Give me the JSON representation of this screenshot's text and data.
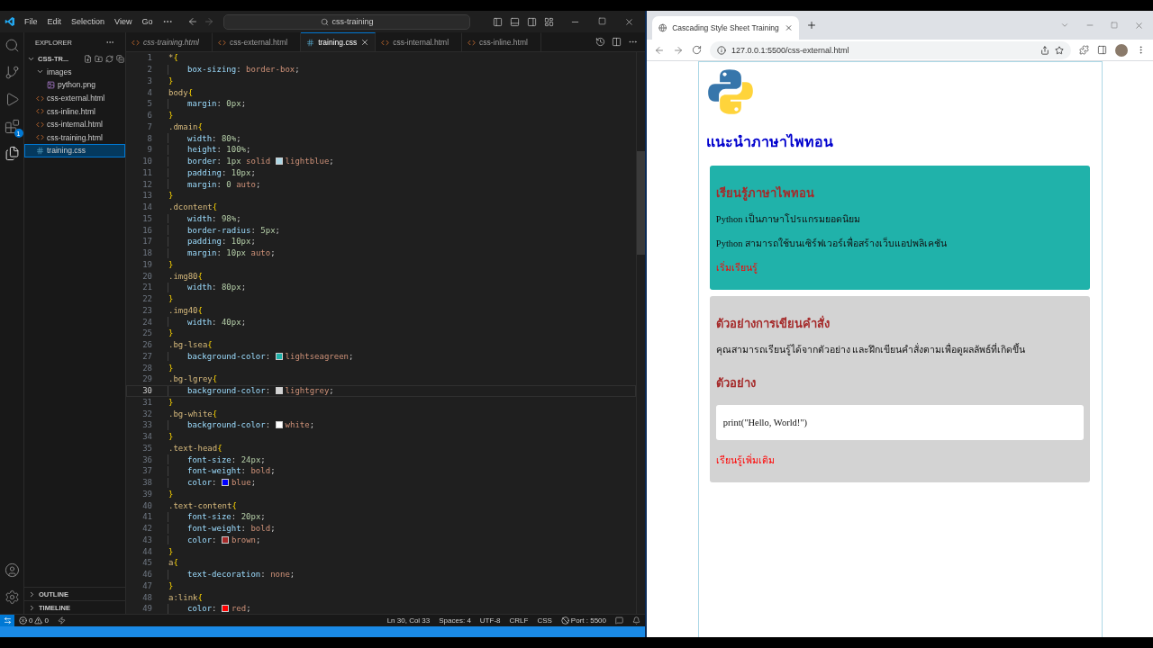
{
  "vscode": {
    "menu": [
      "File",
      "Edit",
      "Selection",
      "View",
      "Go"
    ],
    "command_center": "css-training",
    "activity_bar": {
      "items": [
        {
          "kind": "search",
          "selected": false
        },
        {
          "kind": "source-control",
          "selected": false
        },
        {
          "kind": "run",
          "selected": false
        },
        {
          "kind": "extensions",
          "selected": false,
          "badge": "1"
        },
        {
          "kind": "explorer",
          "selected": true
        }
      ],
      "bottom": [
        {
          "kind": "account"
        },
        {
          "kind": "settings"
        }
      ]
    },
    "explorer": {
      "title": "EXPLORER",
      "root": {
        "label": "CSS-TR...",
        "expanded": true,
        "children": [
          {
            "kind": "folder",
            "label": "images",
            "expanded": true,
            "selected": false,
            "children": [
              {
                "kind": "image",
                "label": "python.png",
                "selected": false
              }
            ]
          },
          {
            "kind": "html",
            "label": "css-external.html",
            "selected": false
          },
          {
            "kind": "html",
            "label": "css-inline.html",
            "selected": false
          },
          {
            "kind": "html",
            "label": "css-internal.html",
            "selected": false
          },
          {
            "kind": "html",
            "label": "css-training.html",
            "selected": false
          },
          {
            "kind": "css",
            "label": "training.css",
            "selected": true
          }
        ]
      },
      "sections": [
        {
          "label": "OUTLINE",
          "expanded": false
        },
        {
          "label": "TIMELINE",
          "expanded": false
        }
      ]
    },
    "tabs": [
      {
        "kind": "html",
        "label": "css-training.html",
        "selected": false,
        "preview": true
      },
      {
        "kind": "html",
        "label": "css-external.html",
        "selected": false,
        "preview": false
      },
      {
        "kind": "css",
        "label": "training.css",
        "selected": true,
        "preview": false
      },
      {
        "kind": "html",
        "label": "css-internal.html",
        "selected": false,
        "preview": false
      },
      {
        "kind": "html",
        "label": "css-inline.html",
        "selected": false,
        "preview": false
      }
    ],
    "lines": [
      {
        "n": "1",
        "text": "*{",
        "active": false
      },
      {
        "n": "2",
        "text": "    box-sizing: border-box;",
        "active": false
      },
      {
        "n": "3",
        "text": "}",
        "active": false
      },
      {
        "n": "4",
        "text": "body{",
        "active": false
      },
      {
        "n": "5",
        "text": "    margin: 0px;",
        "active": false
      },
      {
        "n": "6",
        "text": "}",
        "active": false
      },
      {
        "n": "7",
        "text": ".dmain{",
        "active": false
      },
      {
        "n": "8",
        "text": "    width: 80%;",
        "active": false
      },
      {
        "n": "9",
        "text": "    height: 100%;",
        "active": false
      },
      {
        "n": "10",
        "text": "    border: 1px solid ",
        "color": "#add8e6",
        "after": "lightblue;",
        "active": false
      },
      {
        "n": "11",
        "text": "    padding: 10px;",
        "active": false
      },
      {
        "n": "12",
        "text": "    margin: 0 auto;",
        "active": false
      },
      {
        "n": "13",
        "text": "}",
        "active": false
      },
      {
        "n": "14",
        "text": ".dcontent{",
        "active": false
      },
      {
        "n": "15",
        "text": "    width: 98%;",
        "active": false
      },
      {
        "n": "16",
        "text": "    border-radius: 5px;",
        "active": false
      },
      {
        "n": "17",
        "text": "    padding: 10px;",
        "active": false
      },
      {
        "n": "18",
        "text": "    margin: 10px auto;",
        "active": false
      },
      {
        "n": "19",
        "text": "}",
        "active": false
      },
      {
        "n": "20",
        "text": ".img80{",
        "active": false
      },
      {
        "n": "21",
        "text": "    width: 80px;",
        "active": false
      },
      {
        "n": "22",
        "text": "}",
        "active": false
      },
      {
        "n": "23",
        "text": ".img40{",
        "active": false
      },
      {
        "n": "24",
        "text": "    width: 40px;",
        "active": false
      },
      {
        "n": "25",
        "text": "}",
        "active": false
      },
      {
        "n": "26",
        "text": ".bg-lsea{",
        "active": false
      },
      {
        "n": "27",
        "text": "    background-color: ",
        "color": "#20b2aa",
        "after": "lightseagreen;",
        "active": false
      },
      {
        "n": "28",
        "text": "}",
        "active": false
      },
      {
        "n": "29",
        "text": ".bg-lgrey{",
        "active": false
      },
      {
        "n": "30",
        "text": "    background-color: ",
        "color": "#d3d3d3",
        "after": "lightgrey;",
        "active": true
      },
      {
        "n": "31",
        "text": "}",
        "active": false
      },
      {
        "n": "32",
        "text": ".bg-white{",
        "active": false
      },
      {
        "n": "33",
        "text": "    background-color: ",
        "color": "#ffffff",
        "after": "white;",
        "active": false
      },
      {
        "n": "34",
        "text": "}",
        "active": false
      },
      {
        "n": "35",
        "text": ".text-head{",
        "active": false
      },
      {
        "n": "36",
        "text": "    font-size: 24px;",
        "active": false
      },
      {
        "n": "37",
        "text": "    font-weight: bold;",
        "active": false
      },
      {
        "n": "38",
        "text": "    color: ",
        "color": "#0000ff",
        "after": "blue;",
        "active": false
      },
      {
        "n": "39",
        "text": "}",
        "active": false
      },
      {
        "n": "40",
        "text": ".text-content{",
        "active": false
      },
      {
        "n": "41",
        "text": "    font-size: 20px;",
        "active": false
      },
      {
        "n": "42",
        "text": "    font-weight: bold;",
        "active": false
      },
      {
        "n": "43",
        "text": "    color: ",
        "color": "#a52a2a",
        "after": "brown;",
        "active": false
      },
      {
        "n": "44",
        "text": "}",
        "active": false
      },
      {
        "n": "45",
        "text": "a{",
        "active": false
      },
      {
        "n": "46",
        "text": "    text-decoration: none;",
        "active": false
      },
      {
        "n": "47",
        "text": "}",
        "active": false
      },
      {
        "n": "48",
        "text": "a:link{",
        "active": false
      },
      {
        "n": "49",
        "text": "    color: ",
        "color": "#ff0000",
        "after": "red;",
        "active": false
      }
    ],
    "status_bar": {
      "errors": "0",
      "warnings": "0",
      "items": [
        "Ln 30, Col 33",
        "Spaces: 4",
        "UTF-8",
        "CRLF",
        "CSS"
      ],
      "port": "Port : 5500"
    }
  },
  "browser": {
    "tab": {
      "title": "Cascading Style Sheet Training"
    },
    "url": "127.0.0.1:5500/css-external.html",
    "page": {
      "heading": "แนะนำภาษาไพทอน",
      "cards": [
        {
          "color": "#20b2aa",
          "blocks": [
            {
              "kind": "heading",
              "text": "เรียนรู้ภาษาไพทอน"
            },
            {
              "kind": "para",
              "text": "Python เป็นภาษาโปรแกรมยอดนิยม"
            },
            {
              "kind": "para",
              "text": "Python สามารถใช้บนเซิร์ฟเวอร์เพื่อสร้างเว็บแอปพลิเคชัน"
            },
            {
              "kind": "link",
              "text": "เริ่มเรียนรู้"
            }
          ]
        },
        {
          "color": "#d3d3d3",
          "blocks": [
            {
              "kind": "heading",
              "text": "ตัวอย่างการเขียนคำสั่ง"
            },
            {
              "kind": "para",
              "text": "คุณสามารถเรียนรู้ได้จากตัวอย่าง และฝึกเขียนคำสั่งตามเพื่อดูผลลัพธ์ที่เกิดขึ้น"
            },
            {
              "kind": "heading",
              "text": "ตัวอย่าง"
            },
            {
              "kind": "code",
              "text": "print(\"Hello, World!\")"
            },
            {
              "kind": "link",
              "text": "เรียนรู้เพิ่มเติม"
            }
          ]
        }
      ]
    }
  }
}
